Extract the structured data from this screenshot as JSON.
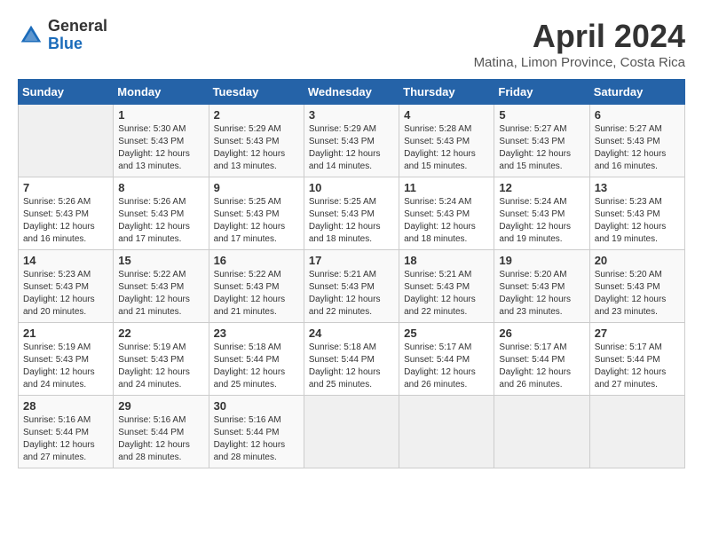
{
  "logo": {
    "general": "General",
    "blue": "Blue"
  },
  "title": "April 2024",
  "subtitle": "Matina, Limon Province, Costa Rica",
  "days_header": [
    "Sunday",
    "Monday",
    "Tuesday",
    "Wednesday",
    "Thursday",
    "Friday",
    "Saturday"
  ],
  "weeks": [
    [
      {
        "day": "",
        "info": ""
      },
      {
        "day": "1",
        "info": "Sunrise: 5:30 AM\nSunset: 5:43 PM\nDaylight: 12 hours\nand 13 minutes."
      },
      {
        "day": "2",
        "info": "Sunrise: 5:29 AM\nSunset: 5:43 PM\nDaylight: 12 hours\nand 13 minutes."
      },
      {
        "day": "3",
        "info": "Sunrise: 5:29 AM\nSunset: 5:43 PM\nDaylight: 12 hours\nand 14 minutes."
      },
      {
        "day": "4",
        "info": "Sunrise: 5:28 AM\nSunset: 5:43 PM\nDaylight: 12 hours\nand 15 minutes."
      },
      {
        "day": "5",
        "info": "Sunrise: 5:27 AM\nSunset: 5:43 PM\nDaylight: 12 hours\nand 15 minutes."
      },
      {
        "day": "6",
        "info": "Sunrise: 5:27 AM\nSunset: 5:43 PM\nDaylight: 12 hours\nand 16 minutes."
      }
    ],
    [
      {
        "day": "7",
        "info": "Sunrise: 5:26 AM\nSunset: 5:43 PM\nDaylight: 12 hours\nand 16 minutes."
      },
      {
        "day": "8",
        "info": "Sunrise: 5:26 AM\nSunset: 5:43 PM\nDaylight: 12 hours\nand 17 minutes."
      },
      {
        "day": "9",
        "info": "Sunrise: 5:25 AM\nSunset: 5:43 PM\nDaylight: 12 hours\nand 17 minutes."
      },
      {
        "day": "10",
        "info": "Sunrise: 5:25 AM\nSunset: 5:43 PM\nDaylight: 12 hours\nand 18 minutes."
      },
      {
        "day": "11",
        "info": "Sunrise: 5:24 AM\nSunset: 5:43 PM\nDaylight: 12 hours\nand 18 minutes."
      },
      {
        "day": "12",
        "info": "Sunrise: 5:24 AM\nSunset: 5:43 PM\nDaylight: 12 hours\nand 19 minutes."
      },
      {
        "day": "13",
        "info": "Sunrise: 5:23 AM\nSunset: 5:43 PM\nDaylight: 12 hours\nand 19 minutes."
      }
    ],
    [
      {
        "day": "14",
        "info": "Sunrise: 5:23 AM\nSunset: 5:43 PM\nDaylight: 12 hours\nand 20 minutes."
      },
      {
        "day": "15",
        "info": "Sunrise: 5:22 AM\nSunset: 5:43 PM\nDaylight: 12 hours\nand 21 minutes."
      },
      {
        "day": "16",
        "info": "Sunrise: 5:22 AM\nSunset: 5:43 PM\nDaylight: 12 hours\nand 21 minutes."
      },
      {
        "day": "17",
        "info": "Sunrise: 5:21 AM\nSunset: 5:43 PM\nDaylight: 12 hours\nand 22 minutes."
      },
      {
        "day": "18",
        "info": "Sunrise: 5:21 AM\nSunset: 5:43 PM\nDaylight: 12 hours\nand 22 minutes."
      },
      {
        "day": "19",
        "info": "Sunrise: 5:20 AM\nSunset: 5:43 PM\nDaylight: 12 hours\nand 23 minutes."
      },
      {
        "day": "20",
        "info": "Sunrise: 5:20 AM\nSunset: 5:43 PM\nDaylight: 12 hours\nand 23 minutes."
      }
    ],
    [
      {
        "day": "21",
        "info": "Sunrise: 5:19 AM\nSunset: 5:43 PM\nDaylight: 12 hours\nand 24 minutes."
      },
      {
        "day": "22",
        "info": "Sunrise: 5:19 AM\nSunset: 5:43 PM\nDaylight: 12 hours\nand 24 minutes."
      },
      {
        "day": "23",
        "info": "Sunrise: 5:18 AM\nSunset: 5:44 PM\nDaylight: 12 hours\nand 25 minutes."
      },
      {
        "day": "24",
        "info": "Sunrise: 5:18 AM\nSunset: 5:44 PM\nDaylight: 12 hours\nand 25 minutes."
      },
      {
        "day": "25",
        "info": "Sunrise: 5:17 AM\nSunset: 5:44 PM\nDaylight: 12 hours\nand 26 minutes."
      },
      {
        "day": "26",
        "info": "Sunrise: 5:17 AM\nSunset: 5:44 PM\nDaylight: 12 hours\nand 26 minutes."
      },
      {
        "day": "27",
        "info": "Sunrise: 5:17 AM\nSunset: 5:44 PM\nDaylight: 12 hours\nand 27 minutes."
      }
    ],
    [
      {
        "day": "28",
        "info": "Sunrise: 5:16 AM\nSunset: 5:44 PM\nDaylight: 12 hours\nand 27 minutes."
      },
      {
        "day": "29",
        "info": "Sunrise: 5:16 AM\nSunset: 5:44 PM\nDaylight: 12 hours\nand 28 minutes."
      },
      {
        "day": "30",
        "info": "Sunrise: 5:16 AM\nSunset: 5:44 PM\nDaylight: 12 hours\nand 28 minutes."
      },
      {
        "day": "",
        "info": ""
      },
      {
        "day": "",
        "info": ""
      },
      {
        "day": "",
        "info": ""
      },
      {
        "day": "",
        "info": ""
      }
    ]
  ]
}
